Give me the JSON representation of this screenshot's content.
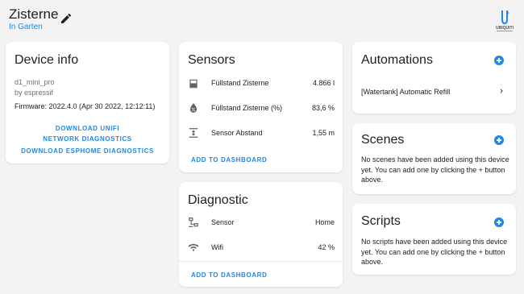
{
  "header": {
    "title": "Zisterne",
    "area": "In Garten",
    "logo_text": "UBIQUITI"
  },
  "device_info": {
    "title": "Device info",
    "model": "d1_mini_pro",
    "manufacturer": "by espressif",
    "firmware": "Firmware: 2022.4.0 (Apr 30 2022, 12:12:11)",
    "download_unifi": "DOWNLOAD UNIFI NETWORK DIAGNOSTICS",
    "download_esphome": "DOWNLOAD ESPHOME DIAGNOSTICS"
  },
  "sensors": {
    "title": "Sensors",
    "rows": [
      {
        "icon": "water-tank-icon",
        "label": "Füllstand Zisterne",
        "value": "4.866 l"
      },
      {
        "icon": "water-percent-icon",
        "label": "Füllstand Zisterne (%)",
        "value": "83,6 %"
      },
      {
        "icon": "arrow-expand-vertical-icon",
        "label": "Sensor Abstand",
        "value": "1,55 m"
      }
    ],
    "add_button": "ADD TO DASHBOARD"
  },
  "diagnostic": {
    "title": "Diagnostic",
    "rows": [
      {
        "icon": "lan-icon",
        "label": "Sensor",
        "value": "Home"
      },
      {
        "icon": "wifi-icon",
        "label": "Wifi",
        "value": "42 %"
      }
    ],
    "add_button": "ADD TO DASHBOARD"
  },
  "automations": {
    "title": "Automations",
    "items": [
      {
        "label": "[Watertank] Automatic Refill"
      }
    ]
  },
  "scenes": {
    "title": "Scenes",
    "empty_text": "No scenes have been added using this device yet. You can add one by clicking the + button above."
  },
  "scripts": {
    "title": "Scripts",
    "empty_text": "No scripts have been added using this device yet. You can add one by clicking the + button above."
  },
  "colors": {
    "accent": "#1e88e5",
    "background": "#f3f3f3",
    "card": "#ffffff",
    "text": "#212121",
    "secondary_text": "#727272"
  }
}
